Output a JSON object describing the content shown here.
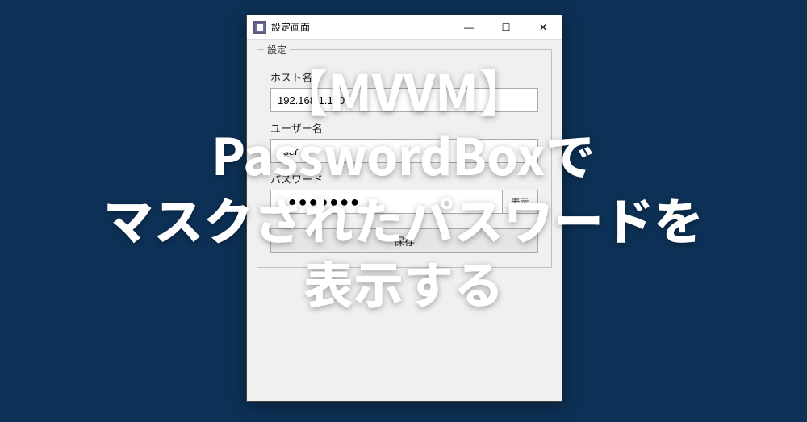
{
  "window": {
    "title": "設定画面",
    "controls": {
      "minimize": "—",
      "maximize": "☐",
      "close": "✕"
    }
  },
  "group": {
    "legend": "設定"
  },
  "fields": {
    "host": {
      "label": "ホスト名",
      "value": "192.168.1.100"
    },
    "user": {
      "label": "ユーザー名",
      "value": "user"
    },
    "password": {
      "label": "パスワード",
      "value": "●●●●●●●●",
      "toggle": "表示"
    }
  },
  "save_button": "保存",
  "overlay": {
    "text": "【MVVM】\nPasswordBoxで\nマスクされたパスワードを\n表示する"
  }
}
